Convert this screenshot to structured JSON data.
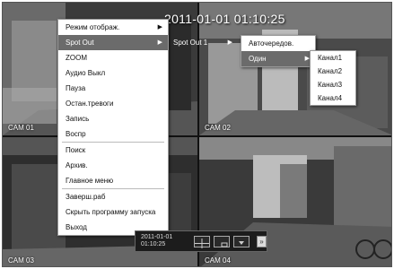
{
  "datetime": "2011-01-01 01:10:25",
  "cameras": [
    "CAM 01",
    "CAM 02",
    "CAM 03",
    "CAM 04"
  ],
  "main_menu": [
    {
      "label": "Режим отображ.",
      "submenu": true
    },
    {
      "label": "Spot Out",
      "submenu": true,
      "selected": true
    },
    {
      "label": "ZOOM"
    },
    {
      "label": "Аудио Выкл"
    },
    {
      "label": "Пауза"
    },
    {
      "label": "Остан.тревоги"
    },
    {
      "label": "Запись"
    },
    {
      "label": "Воспр"
    },
    {
      "label": "Поиск"
    },
    {
      "label": "Архив."
    },
    {
      "label": "Главное меню"
    },
    {
      "label": "Заверш.раб"
    },
    {
      "label": "Скрыть программу запуска"
    },
    {
      "label": "Выход"
    }
  ],
  "spot_menu": {
    "label": "Spot Out 1"
  },
  "mode_menu": [
    {
      "label": "Авточередов."
    },
    {
      "label": "Один",
      "selected": true
    }
  ],
  "channel_menu": [
    "Канал1",
    "Канал2",
    "Канал3",
    "Канал4"
  ],
  "taskbar": {
    "date": "2011-01-01",
    "time": "01:10:25"
  }
}
